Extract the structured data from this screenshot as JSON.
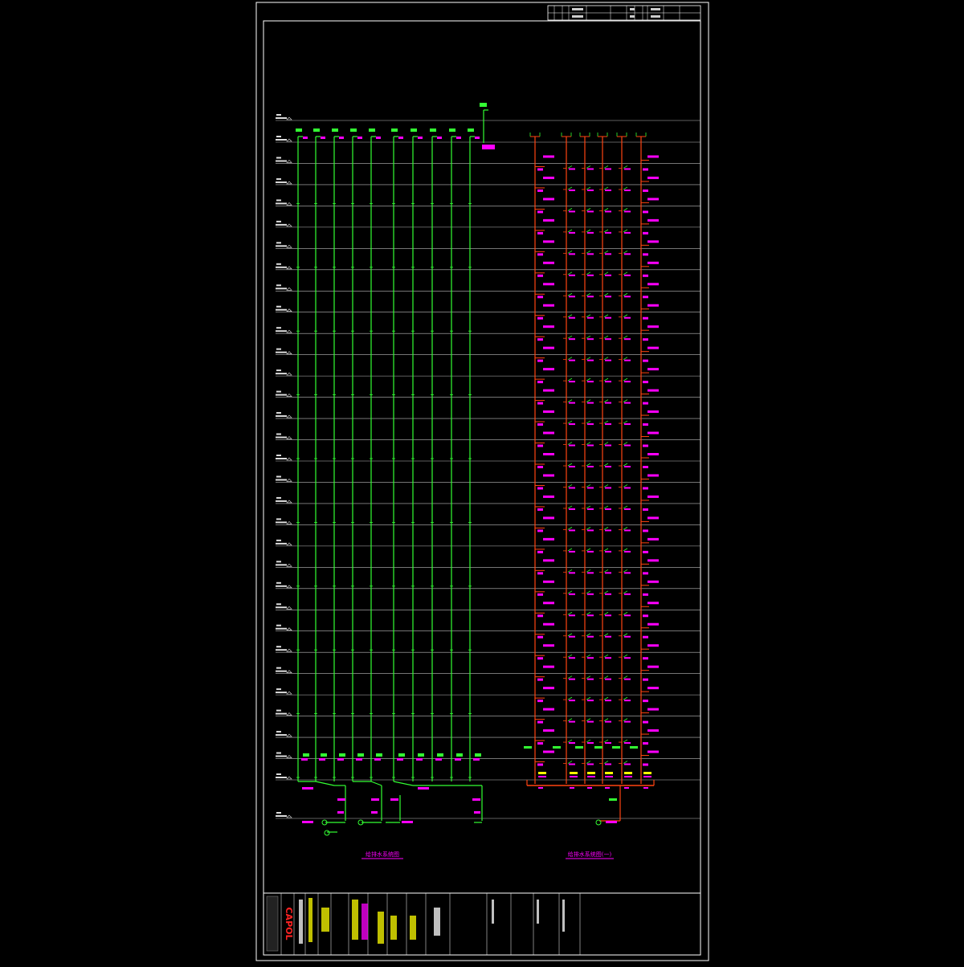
{
  "drawing": {
    "left_title": "给排水系统图",
    "right_title": "给排水系统图(一)",
    "brand": "CAPOL"
  },
  "colors": {
    "background": "#000000",
    "frame": "#ffffff",
    "supply_pipe": "#33ff33",
    "drain_pipe": "#ff4411",
    "annotation": "#ff00ff",
    "label_bg": "#ffff00",
    "level_line": "#ffffff",
    "brand": "#ff2222"
  },
  "floors": {
    "count": 30
  },
  "left_risers": {
    "count": 10
  },
  "right_risers": {
    "count": 7
  },
  "icons": [
    "floor-level-symbol",
    "valve-icon",
    "pump-icon",
    "flow-arrow-icon"
  ]
}
